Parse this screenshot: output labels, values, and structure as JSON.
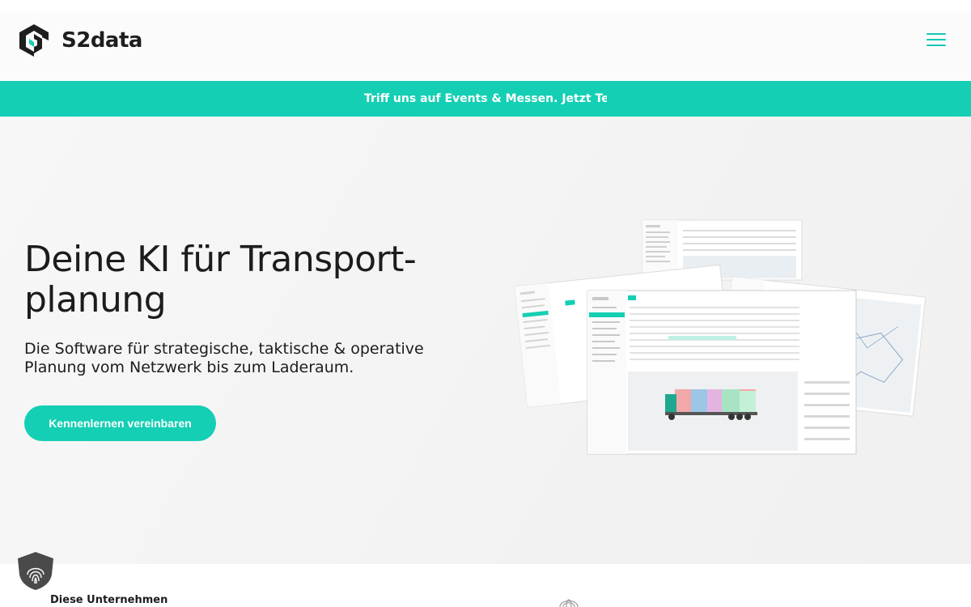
{
  "brand": {
    "name": "S2data",
    "accent": "#14cfb4"
  },
  "header": {
    "menu_icon": "hamburger-icon"
  },
  "banner": {
    "text": "Triff uns auf Events & Messen. Jetzt Termi"
  },
  "hero": {
    "title": "Deine KI für Transport-planung",
    "subtitle": "Die Software für strategische, taktische & operative Planung vom Netzwerk bis zum Laderaum.",
    "cta_label": "Kennenlernen vereinbaren"
  },
  "bottom": {
    "text": "Diese Unternehmen",
    "badge_icon": "fingerprint-shield-icon"
  }
}
